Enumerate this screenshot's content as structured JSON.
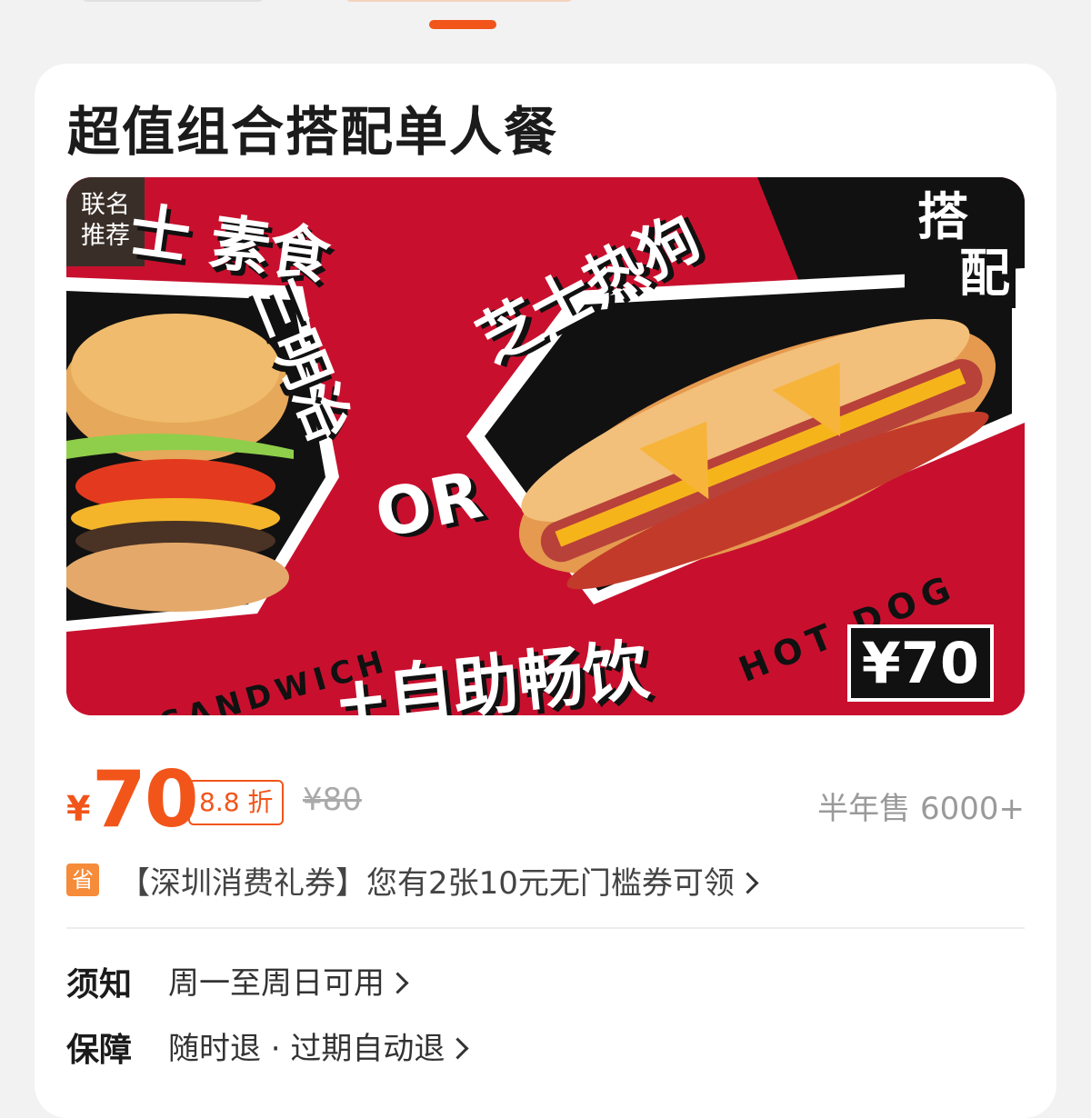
{
  "product": {
    "title": "超值组合搭配单人餐"
  },
  "banner": {
    "badge_line1": "联名",
    "badge_line2": "推荐",
    "text_cheese_veg": "士 素食",
    "text_sandwich_cn": "三明治",
    "text_hotdog_cn": "芝士热狗",
    "text_combo_line1": "搭",
    "text_combo_line2": "配",
    "text_or": "OR",
    "text_sandwich_en": "SANDWICH",
    "text_hotdog_en": "HOT DOG",
    "text_drink": "+自助畅饮",
    "text_price_tag": "¥70",
    "background_color": "#c8102e"
  },
  "pricing": {
    "currency": "¥",
    "price": "70",
    "discount": "8.8 折",
    "original_price": "¥80",
    "sales": "半年售 6000+",
    "accent_color": "#f2551a"
  },
  "coupon": {
    "badge": "省",
    "text": "【深圳消费礼券】您有2张10元无门槛券可领",
    "icon": "chevron-right-icon"
  },
  "notice": {
    "label": "须知",
    "value": "周一至周日可用"
  },
  "guarantee": {
    "label": "保障",
    "value": "随时退 · 过期自动退"
  }
}
